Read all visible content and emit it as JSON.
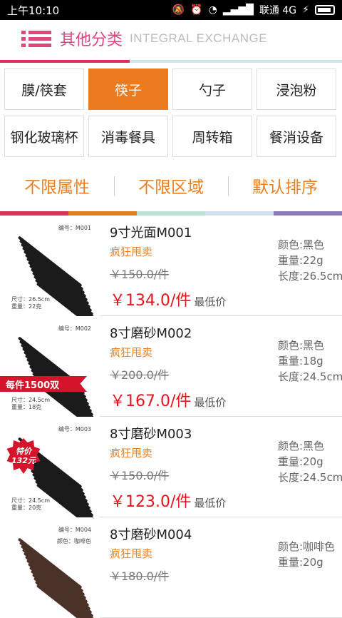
{
  "statusbar": {
    "time": "上午10:10",
    "carrier": "联通 4G"
  },
  "header": {
    "title": "其他分类",
    "subtitle": "INTEGRAL EXCHANGE"
  },
  "categories": [
    {
      "label": "膜/筷套",
      "active": false
    },
    {
      "label": "筷子",
      "active": true
    },
    {
      "label": "勺子",
      "active": false
    },
    {
      "label": "浸泡粉",
      "active": false
    },
    {
      "label": "钢化玻璃杯",
      "active": false
    },
    {
      "label": "消毒餐具",
      "active": false
    },
    {
      "label": "周转箱",
      "active": false
    },
    {
      "label": "餐消设备",
      "active": false
    }
  ],
  "filters": [
    "不限属性",
    "不限区域",
    "默认排序"
  ],
  "band_colors": [
    "#d8335a",
    "#ec7a1f",
    "#bfe1d5",
    "#cfe0ea",
    "#8b7bbd"
  ],
  "products": [
    {
      "name": "9寸光面M001",
      "tag": "疯狂甩卖",
      "old_price": "￥150.0/件",
      "price": "￥134.0/件",
      "low_label": "最低价",
      "attrs": [
        "颜色:黑色",
        "重量:22g",
        "长度:26.5cm"
      ],
      "thumb": {
        "code": "编号：M001",
        "spec1": "尺寸：26.5cm",
        "spec2": "重量：22克",
        "color_note": ""
      },
      "stick_color": "#1b1b1b",
      "badge": ""
    },
    {
      "name": "8寸磨砂M002",
      "tag": "疯狂甩卖",
      "old_price": "￥200.0/件",
      "price": "￥167.0/件",
      "low_label": "最低价",
      "attrs": [
        "颜色:黑色",
        "重量:18g",
        "长度:24.5cm"
      ],
      "thumb": {
        "code": "编号：M002",
        "spec1": "尺寸：24.5cm",
        "spec2": "重量：18克",
        "color_note": ""
      },
      "stick_color": "#1b1b1b",
      "badge": "每件1500双"
    },
    {
      "name": "8寸磨砂M003",
      "tag": "疯狂甩卖",
      "old_price": "￥150.0/件",
      "price": "￥123.0/件",
      "low_label": "最低价",
      "attrs": [
        "颜色:黑色",
        "重量:20g",
        "长度:24.5cm"
      ],
      "thumb": {
        "code": "编号：M003",
        "spec1": "尺寸：24.5cm",
        "spec2": "重量：20克",
        "color_note": ""
      },
      "stick_color": "#1b1b1b",
      "badge_star": [
        "特价",
        "132元"
      ]
    },
    {
      "name": "8寸磨砂M004",
      "tag": "疯狂甩卖",
      "old_price": "￥180.0/件",
      "price": "",
      "low_label": "",
      "attrs": [
        "颜色:咖啡色",
        "重量:20g",
        ""
      ],
      "thumb": {
        "code": "编号：M004",
        "spec1": "",
        "spec2": "",
        "color_note": "颜色：咖啡色"
      },
      "stick_color": "#4a3228",
      "badge": ""
    }
  ]
}
